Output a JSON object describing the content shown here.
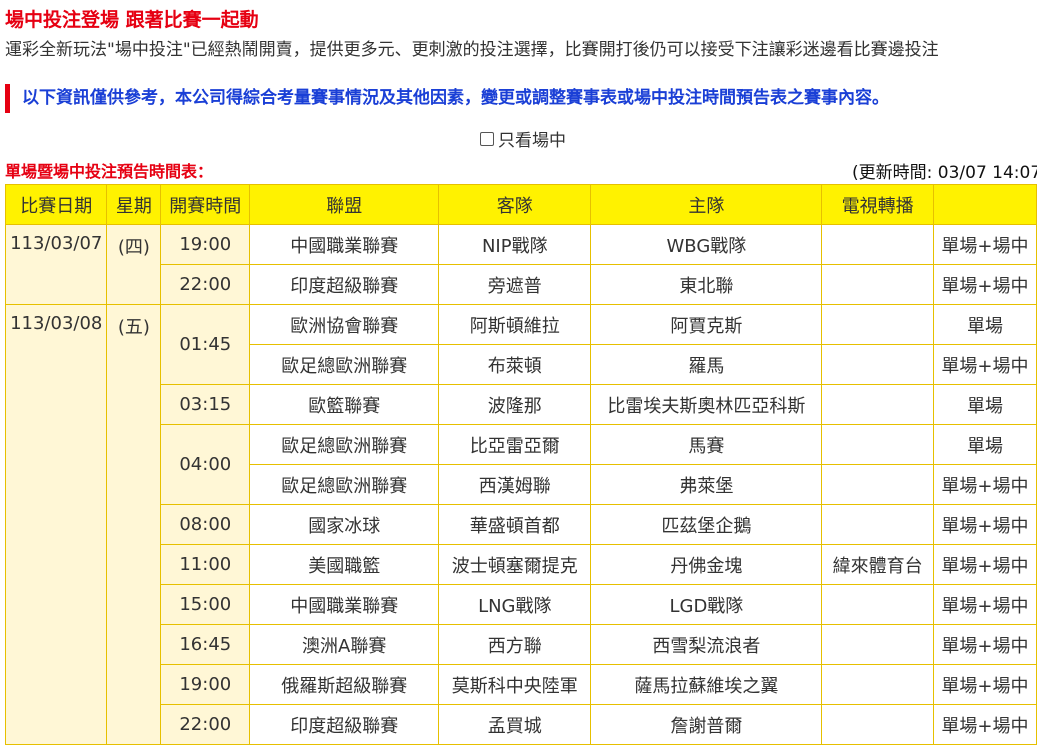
{
  "header": {
    "title": "場中投注登場 跟著比賽一起動",
    "subtitle": "運彩全新玩法\"場中投注\"已經熱鬧開賣，提供更多元、更刺激的投注選擇，比賽開打後仍可以接受下注讓彩迷邊看比賽邊投注"
  },
  "notice": "以下資訊僅供參考，本公司得綜合考量賽事情況及其他因素，變更或調整賽事表或場中投注時間預告表之賽事內容。",
  "filter": {
    "label": "只看場中",
    "checked": false
  },
  "schedule": {
    "label": "單場暨場中投注預告時間表：",
    "updated": "(更新時間: 03/07 14:07"
  },
  "columns": [
    "比賽日期",
    "星期",
    "開賽時間",
    "聯盟",
    "客隊",
    "主隊",
    "電視轉播",
    ""
  ],
  "days": [
    {
      "date": "113/03/07",
      "weekday": "(四)",
      "slots": [
        {
          "time": "19:00",
          "games": [
            {
              "league": "中國職業聯賽",
              "away": "NIP戰隊",
              "home": "WBG戰隊",
              "tv": "",
              "type": "單場+場中"
            }
          ]
        },
        {
          "time": "22:00",
          "games": [
            {
              "league": "印度超級聯賽",
              "away": "旁遮普",
              "home": "東北聯",
              "tv": "",
              "type": "單場+場中"
            }
          ]
        }
      ]
    },
    {
      "date": "113/03/08",
      "weekday": "(五)",
      "slots": [
        {
          "time": "01:45",
          "games": [
            {
              "league": "歐洲協會聯賽",
              "away": "阿斯頓維拉",
              "home": "阿賈克斯",
              "tv": "",
              "type": "單場"
            },
            {
              "league": "歐足總歐洲聯賽",
              "away": "布萊頓",
              "home": "羅馬",
              "tv": "",
              "type": "單場+場中"
            }
          ]
        },
        {
          "time": "03:15",
          "games": [
            {
              "league": "歐籃聯賽",
              "away": "波隆那",
              "home": "比雷埃夫斯奧林匹亞科斯",
              "tv": "",
              "type": "單場"
            }
          ]
        },
        {
          "time": "04:00",
          "games": [
            {
              "league": "歐足總歐洲聯賽",
              "away": "比亞雷亞爾",
              "home": "馬賽",
              "tv": "",
              "type": "單場"
            },
            {
              "league": "歐足總歐洲聯賽",
              "away": "西漢姆聯",
              "home": "弗萊堡",
              "tv": "",
              "type": "單場+場中"
            }
          ]
        },
        {
          "time": "08:00",
          "games": [
            {
              "league": "國家冰球",
              "away": "華盛頓首都",
              "home": "匹茲堡企鵝",
              "tv": "",
              "type": "單場+場中"
            }
          ]
        },
        {
          "time": "11:00",
          "games": [
            {
              "league": "美國職籃",
              "away": "波士頓塞爾提克",
              "home": "丹佛金塊",
              "tv": "緯來體育台",
              "type": "單場+場中"
            }
          ]
        },
        {
          "time": "15:00",
          "games": [
            {
              "league": "中國職業聯賽",
              "away": "LNG戰隊",
              "home": "LGD戰隊",
              "tv": "",
              "type": "單場+場中"
            }
          ]
        },
        {
          "time": "16:45",
          "games": [
            {
              "league": "澳洲A聯賽",
              "away": "西方聯",
              "home": "西雪梨流浪者",
              "tv": "",
              "type": "單場+場中"
            }
          ]
        },
        {
          "time": "19:00",
          "games": [
            {
              "league": "俄羅斯超級聯賽",
              "away": "莫斯科中央陸軍",
              "home": "薩馬拉蘇維埃之翼",
              "tv": "",
              "type": "單場+場中"
            }
          ]
        },
        {
          "time": "22:00",
          "games": [
            {
              "league": "印度超級聯賽",
              "away": "孟買城",
              "home": "詹謝普爾",
              "tv": "",
              "type": "單場+場中"
            }
          ]
        }
      ]
    }
  ]
}
